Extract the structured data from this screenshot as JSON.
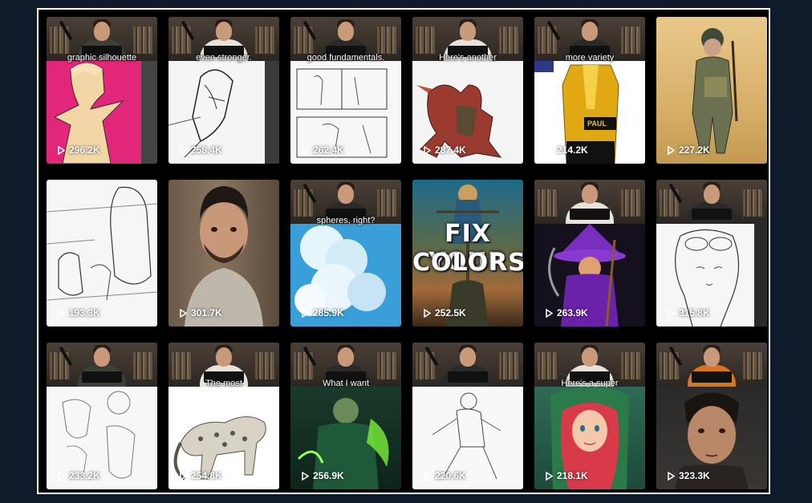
{
  "tiles": [
    {
      "caption": "graphic silhouette",
      "views": "296.2K"
    },
    {
      "caption": "even stronger.",
      "views": "258.4K"
    },
    {
      "caption": "good fundamentals.",
      "views": "262.4K"
    },
    {
      "caption": "Here's another",
      "views": "287.4K"
    },
    {
      "caption": "more variety",
      "views": "214.2K",
      "label": "PAUL"
    },
    {
      "caption": "",
      "views": "227.2K"
    },
    {
      "caption": "",
      "views": "193.3K"
    },
    {
      "caption": "",
      "views": "301.7K"
    },
    {
      "caption": "spheres, right?",
      "views": "285.9K"
    },
    {
      "caption": "",
      "views": "252.5K",
      "overlay_line1": "FIX YOUR",
      "overlay_line2": "COLORS"
    },
    {
      "caption": "",
      "views": "263.9K"
    },
    {
      "caption": "",
      "views": "315.8K"
    },
    {
      "caption": "",
      "views": "233.2K"
    },
    {
      "caption": "The most",
      "views": "254.8K"
    },
    {
      "caption": "What I want",
      "views": "256.9K"
    },
    {
      "caption": "",
      "views": "220.6K"
    },
    {
      "caption": "Here's a super",
      "views": "218.1K"
    },
    {
      "caption": "",
      "views": "323.3K"
    }
  ],
  "icons": {
    "play": "play-icon"
  },
  "colors": {
    "background": "#0f1a2a",
    "frame_border": "#ffffff",
    "pink_panel": "#e2267a",
    "sky_blue": "#3a9fd8"
  }
}
